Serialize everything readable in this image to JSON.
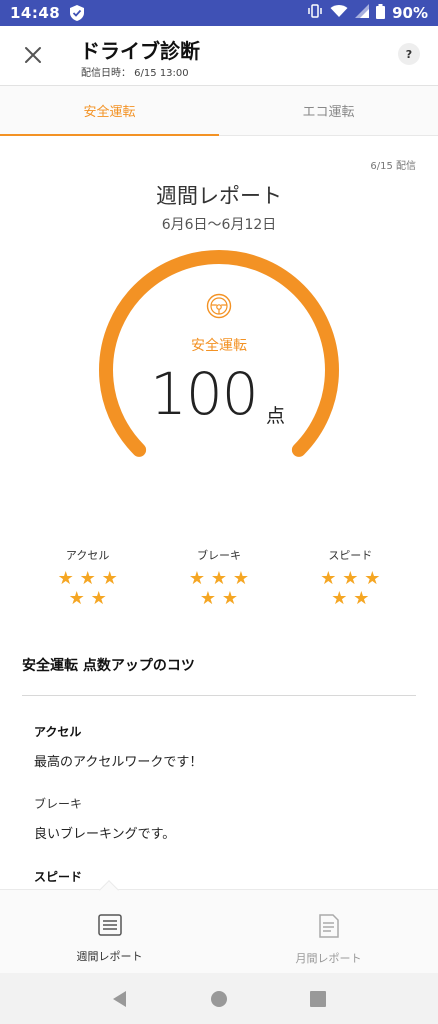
{
  "status_bar": {
    "time": "14:48",
    "battery": "90%",
    "bg_color": "#3f51b5"
  },
  "header": {
    "title": "ドライブ診断",
    "subtitle": "配信日時： 6/15 13:00",
    "help_label": "?"
  },
  "tabs": [
    {
      "label": "安全運転",
      "active": true
    },
    {
      "label": "エコ運転",
      "active": false
    }
  ],
  "report": {
    "distribution_date": "6/15 配信",
    "title": "週間レポート",
    "range": "6月6日～6月12日",
    "gauge_label": "安全運転",
    "score": "100",
    "unit": "点",
    "score_fraction": 1.0
  },
  "ratings": [
    {
      "label": "アクセル",
      "stars": 5
    },
    {
      "label": "ブレーキ",
      "stars": 5
    },
    {
      "label": "スピード",
      "stars": 5
    }
  ],
  "tips": {
    "title": "安全運転 点数アップのコツ",
    "items": [
      {
        "heading": "アクセル",
        "body": "最高のアクセルワークです！"
      },
      {
        "heading": "ブレーキ",
        "body": "良いブレーキングです。"
      },
      {
        "heading": "スピード",
        "body": ""
      }
    ]
  },
  "bottom_nav": [
    {
      "label": "週間レポート",
      "icon": "list-icon",
      "active": true
    },
    {
      "label": "月間レポート",
      "icon": "document-icon",
      "active": false
    }
  ],
  "colors": {
    "accent": "#f39224",
    "star": "#f5a623"
  }
}
